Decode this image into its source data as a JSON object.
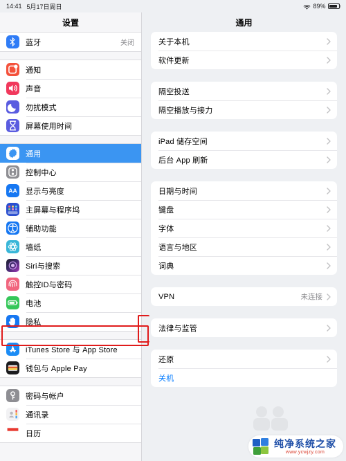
{
  "status_bar": {
    "time": "14:41",
    "date": "5月17日周日",
    "wifi_icon": "wifi-icon",
    "battery_percent": "89%",
    "battery_level": 89
  },
  "sidebar": {
    "title": "设置",
    "groups": [
      {
        "items": [
          {
            "label": "蓝牙",
            "value": "关闭",
            "icon": "bluetooth-icon",
            "selected": false
          }
        ]
      },
      {
        "items": [
          {
            "label": "通知",
            "value": "",
            "icon": "notifications-icon",
            "selected": false
          },
          {
            "label": "声音",
            "value": "",
            "icon": "sound-icon",
            "selected": false
          },
          {
            "label": "勿扰模式",
            "value": "",
            "icon": "do-not-disturb-icon",
            "selected": false
          },
          {
            "label": "屏幕使用时间",
            "value": "",
            "icon": "screen-time-icon",
            "selected": false
          }
        ]
      },
      {
        "items": [
          {
            "label": "通用",
            "value": "",
            "icon": "gear-icon",
            "selected": true
          },
          {
            "label": "控制中心",
            "value": "",
            "icon": "control-center-icon",
            "selected": false
          },
          {
            "label": "显示与亮度",
            "value": "",
            "icon": "display-brightness-icon",
            "selected": false
          },
          {
            "label": "主屏幕与程序坞",
            "value": "",
            "icon": "home-screen-dock-icon",
            "selected": false
          },
          {
            "label": "辅助功能",
            "value": "",
            "icon": "accessibility-icon",
            "selected": false
          },
          {
            "label": "墙纸",
            "value": "",
            "icon": "wallpaper-icon",
            "selected": false
          },
          {
            "label": "Siri与搜索",
            "value": "",
            "icon": "siri-icon",
            "selected": false
          },
          {
            "label": "触控ID与密码",
            "value": "",
            "icon": "touch-id-icon",
            "selected": false
          },
          {
            "label": "电池",
            "value": "",
            "icon": "battery-icon",
            "selected": false
          },
          {
            "label": "隐私",
            "value": "",
            "icon": "privacy-hand-icon",
            "selected": false
          }
        ]
      },
      {
        "items": [
          {
            "label": "iTunes Store 与 App Store",
            "value": "",
            "icon": "app-store-icon",
            "selected": false
          },
          {
            "label": "钱包与 Apple Pay",
            "value": "",
            "icon": "wallet-icon",
            "selected": false
          }
        ]
      },
      {
        "items": [
          {
            "label": "密码与帐户",
            "value": "",
            "icon": "passwords-key-icon",
            "selected": false
          },
          {
            "label": "通讯录",
            "value": "",
            "icon": "contacts-icon",
            "selected": false
          },
          {
            "label": "日历",
            "value": "",
            "icon": "calendar-icon",
            "selected": false
          }
        ]
      }
    ]
  },
  "detail": {
    "title": "通用",
    "groups": [
      {
        "rows": [
          {
            "label": "关于本机",
            "value": "",
            "chevron": true,
            "accent": false
          },
          {
            "label": "软件更新",
            "value": "",
            "chevron": true,
            "accent": false
          }
        ]
      },
      {
        "rows": [
          {
            "label": "隔空投送",
            "value": "",
            "chevron": true,
            "accent": false
          },
          {
            "label": "隔空播放与接力",
            "value": "",
            "chevron": true,
            "accent": false
          }
        ]
      },
      {
        "rows": [
          {
            "label": "iPad 储存空间",
            "value": "",
            "chevron": true,
            "accent": false
          },
          {
            "label": "后台 App 刷新",
            "value": "",
            "chevron": true,
            "accent": false
          }
        ]
      },
      {
        "rows": [
          {
            "label": "日期与时间",
            "value": "",
            "chevron": true,
            "accent": false
          },
          {
            "label": "键盘",
            "value": "",
            "chevron": true,
            "accent": false
          },
          {
            "label": "字体",
            "value": "",
            "chevron": true,
            "accent": false
          },
          {
            "label": "语言与地区",
            "value": "",
            "chevron": true,
            "accent": false
          },
          {
            "label": "词典",
            "value": "",
            "chevron": true,
            "accent": false
          }
        ]
      },
      {
        "rows": [
          {
            "label": "VPN",
            "value": "未连接",
            "chevron": true,
            "accent": false
          }
        ]
      },
      {
        "rows": [
          {
            "label": "法律与监管",
            "value": "",
            "chevron": true,
            "accent": false
          }
        ]
      },
      {
        "rows": [
          {
            "label": "还原",
            "value": "",
            "chevron": true,
            "accent": false
          },
          {
            "label": "关机",
            "value": "",
            "chevron": false,
            "accent": true
          }
        ]
      }
    ]
  },
  "annotations": [
    {
      "name": "privacy-highlight",
      "color": "#e01b1b"
    },
    {
      "name": "vpn-highlight",
      "color": "#e01b1b"
    }
  ],
  "watermark": {
    "title": "纯净系统之家",
    "url": "www.ycwjzy.com"
  },
  "colors": {
    "selection": "#3b95f2",
    "accent": "#007aff",
    "annotation": "#e01b1b",
    "pane_bg": "#eef0f3",
    "card_bg": "#ffffff"
  }
}
